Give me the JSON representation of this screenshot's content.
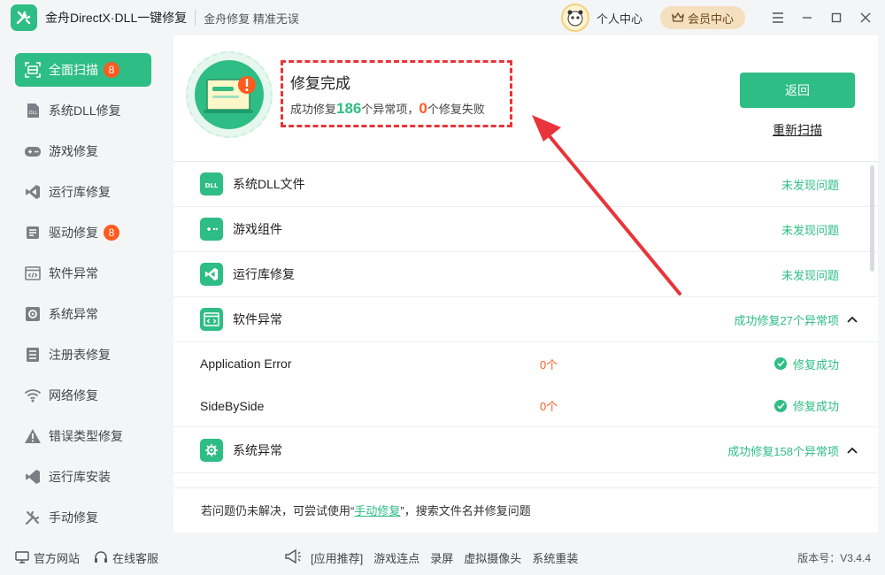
{
  "app": {
    "title": "金舟DirectX·DLL一键修复",
    "subtitle": "金舟修复 精准无误",
    "personal_center": "个人中心",
    "vip_center": "会员中心"
  },
  "sidebar": {
    "items": [
      {
        "label": "全面扫描",
        "badge": "8",
        "icon": "scan-icon"
      },
      {
        "label": "系统DLL修复",
        "badge": "",
        "icon": "dll-icon"
      },
      {
        "label": "游戏修复",
        "badge": "",
        "icon": "gamepad-icon"
      },
      {
        "label": "运行库修复",
        "badge": "",
        "icon": "visual-studio-icon"
      },
      {
        "label": "驱动修复",
        "badge": "8",
        "icon": "driver-icon"
      },
      {
        "label": "软件异常",
        "badge": "",
        "icon": "code-window-icon"
      },
      {
        "label": "系统异常",
        "badge": "",
        "icon": "gear-icon"
      },
      {
        "label": "注册表修复",
        "badge": "",
        "icon": "list-icon"
      },
      {
        "label": "网络修复",
        "badge": "",
        "icon": "wifi-icon"
      },
      {
        "label": "错误类型修复",
        "badge": "",
        "icon": "warning-icon"
      },
      {
        "label": "运行库安装",
        "badge": "",
        "icon": "install-icon"
      },
      {
        "label": "手动修复",
        "badge": "",
        "icon": "wrench-icon"
      }
    ]
  },
  "status": {
    "title": "修复完成",
    "prefix": "成功修复",
    "success_count": "186",
    "middle": "个异常项，",
    "fail_count": "0",
    "suffix": "个修复失败"
  },
  "actions": {
    "back": "返回",
    "rescan": "重新扫描"
  },
  "categories": [
    {
      "label": "系统DLL文件",
      "status": "未发现问题",
      "icon": "dll-icon"
    },
    {
      "label": "游戏组件",
      "status": "未发现问题",
      "icon": "gamepad-icon"
    },
    {
      "label": "运行库修复",
      "status": "未发现问题",
      "icon": "visual-studio-icon"
    },
    {
      "label": "软件异常",
      "status": "成功修复27个异常项",
      "icon": "code-window-icon"
    },
    {
      "label": "系统异常",
      "status": "成功修复158个异常项",
      "icon": "gear-icon"
    }
  ],
  "software_items": [
    {
      "name": "Application Error",
      "count": "0个",
      "result": "修复成功"
    },
    {
      "name": "SideBySide",
      "count": "0个",
      "result": "修复成功"
    }
  ],
  "hint": {
    "before": "若问题仍未解决，可尝试使用“",
    "link": "手动修复",
    "after": "”，搜索文件名并修复问题"
  },
  "footer": {
    "official_site": "官方网站",
    "online_service": "在线客服",
    "recommend": "[应用推荐]",
    "apps": [
      "游戏连点",
      "录屏",
      "虚拟摄像头",
      "系统重装"
    ],
    "version": "版本号：V3.4.4"
  },
  "colors": {
    "accent": "#2ebd85",
    "warning": "#ff5a1f",
    "highlight": "#e8343a"
  }
}
